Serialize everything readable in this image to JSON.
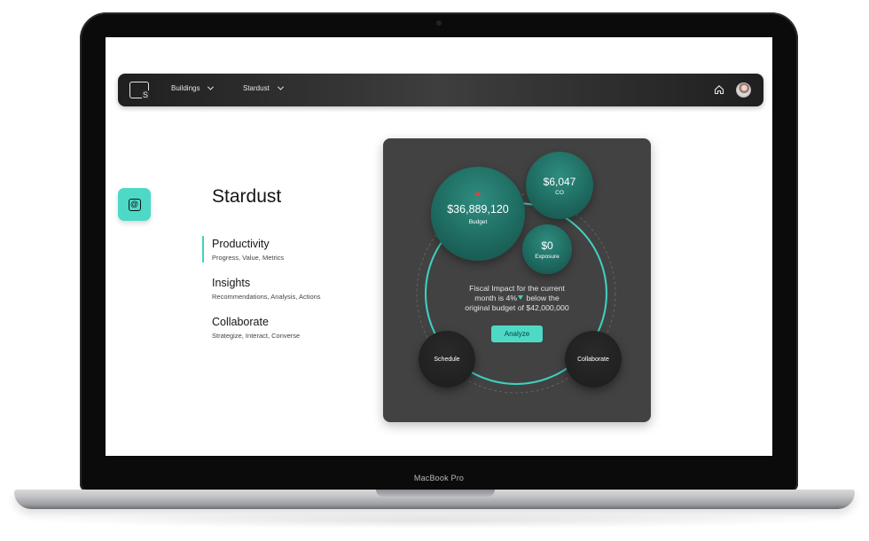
{
  "device": {
    "label": "MacBook Pro"
  },
  "nav": {
    "logo_letter": "S",
    "items": [
      {
        "label": "Buildings"
      },
      {
        "label": "Stardust"
      }
    ],
    "home_icon": "home-icon",
    "avatar": "user-avatar"
  },
  "sidebar": {
    "badge_icon": "at-icon",
    "badge_color": "#4ed9c7"
  },
  "content": {
    "title": "Stardust",
    "sections": [
      {
        "title": "Productivity",
        "subtitle": "Progress, Value, Metrics",
        "active": true
      },
      {
        "title": "Insights",
        "subtitle": "Recommendations, Analysis, Actions",
        "active": false
      },
      {
        "title": "Collaborate",
        "subtitle": "Strategize, Interact, Converse",
        "active": false
      }
    ]
  },
  "card": {
    "budget": {
      "value": "$36,889,120",
      "label": "Budget"
    },
    "co": {
      "value": "$6,047",
      "label": "CO"
    },
    "exposure": {
      "value": "$0",
      "label": "Exposure"
    },
    "impact": {
      "line1": "Fiscal Impact for the current",
      "line2_prefix": "month is 4%",
      "line2_suffix": " below the",
      "line3": "original budget of $42,000,000"
    },
    "analyze_label": "Analyze",
    "schedule_label": "Schedule",
    "collaborate_label": "Collaborate",
    "accent_color": "#3fd1bf",
    "alert_color": "#e2443a"
  }
}
